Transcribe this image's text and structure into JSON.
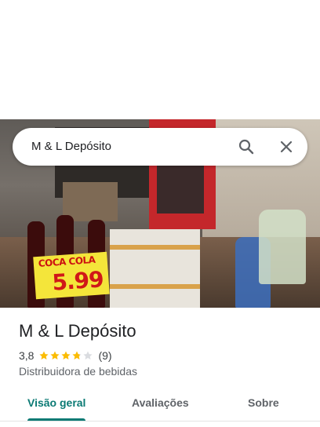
{
  "search": {
    "query": "M & L Depósito",
    "icons": {
      "search": "search-icon",
      "close": "close-icon"
    }
  },
  "photo": {
    "price_tag_brand": "COCA COLA",
    "price_tag_price": "5.99"
  },
  "place": {
    "name": "M & L Depósito",
    "rating": "3,8",
    "rating_stars": 3.8,
    "review_count": "(9)",
    "category": "Distribuidora de bebidas"
  },
  "tabs": [
    {
      "label": "Visão geral",
      "active": true
    },
    {
      "label": "Avaliações",
      "active": false
    },
    {
      "label": "Sobre",
      "active": false
    }
  ],
  "colors": {
    "accent": "#0b7a74",
    "star": "#fbbc04",
    "star_empty": "#dadce0",
    "text_primary": "#202124",
    "text_secondary": "#5f6368"
  }
}
